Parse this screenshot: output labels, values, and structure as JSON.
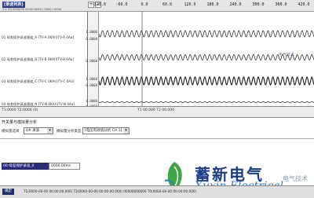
{
  "toolbar": {
    "name_tag": "[录波列表]",
    "info_line": "2.1 (0) 0000/00 00:00:0000 / 0000 / 0000",
    "time_labels": [
      "-120.0",
      "-60.0",
      "0.0",
      "60.0",
      "120.0",
      "180.0",
      "240.0",
      "300.0",
      "360.0",
      "420.0"
    ]
  },
  "channels": [
    {
      "label": "01 母差保护录波通道_A [TV-A 0KA(I)TV-A 0Aa]",
      "top": "1.0000",
      "bottom": "-0.0000"
    },
    {
      "label": "02 母差保护录波通道_B [TV-B 0KA(I)TV-B 0Aa]",
      "top": "",
      "bottom": "-0.0000"
    },
    {
      "label": "03 母差保护录波通道_C [TV-C 0KA(I)TV-C 0Aa]",
      "top": "1.0000",
      "bottom": "-0.0000"
    },
    {
      "label": "04 母差保护录波通道_N [TV-N 0KA(I)TV-N 0Aa]",
      "top": "0.0000",
      "bottom": "-0.0000"
    }
  ],
  "status_bar": {
    "left": "T1:0000 T2:0000 (0)",
    "right": "T1 00.000 T2 00.000"
  },
  "analysis": {
    "section_title": "开关量与模拟量分析",
    "select1_label": "模拟量选择",
    "select1_value": "0# 录波",
    "select2_label": "模拟量分析类型",
    "select2_value": "[电压有效值分析 CH 1]"
  },
  "results": {
    "header": "00-母差保护录波_0",
    "value": "0000.00ms"
  },
  "bottom_bar": {
    "button": "确定",
    "info": "T1(0000-00-00 00:00:00.000) T2(0000-00-00 00:00:00.000) 00000000000 T0(0000-00-00 00:00:00.000)"
  },
  "logo": {
    "brand_cn": "蓄新电气",
    "brand_en": "Xuxin Electrical"
  },
  "watermark": {
    "text": "电气技术",
    "small": "电气技术"
  },
  "colors": {
    "wave": "#1a1a1a",
    "title_bg": "#2a3d8f",
    "logo_blue": "#1a3c8c",
    "logo_green": "#3aa843"
  }
}
